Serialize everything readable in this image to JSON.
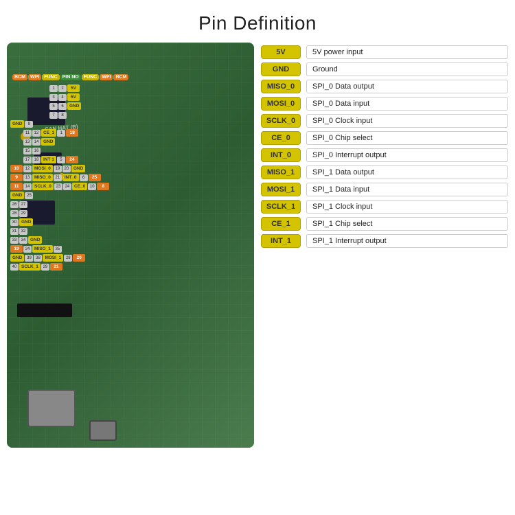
{
  "page": {
    "title": "Pin Definition"
  },
  "header_labels": {
    "bcm": "BCM",
    "wpi": "WPI",
    "func_left": "FUNC",
    "pin_no": "PIN NO",
    "func_right": "FUNC",
    "wpi_right": "WPI",
    "bcm_right": "BCM"
  },
  "legend": [
    {
      "badge": "5V",
      "desc": "5V power input"
    },
    {
      "badge": "GND",
      "desc": "Ground"
    },
    {
      "badge": "MISO_0",
      "desc": "SPI_0 Data output"
    },
    {
      "badge": "MOSI_0",
      "desc": "SPI_0 Data input"
    },
    {
      "badge": "SCLK_0",
      "desc": "SPI_0 Clock input"
    },
    {
      "badge": "CE_0",
      "desc": "SPI_0 Chip select"
    },
    {
      "badge": "INT_0",
      "desc": "SPI_0 Interrupt output"
    },
    {
      "badge": "MISO_1",
      "desc": "SPI_1 Data output"
    },
    {
      "badge": "MOSI_1",
      "desc": "SPI_1 Data input"
    },
    {
      "badge": "SCLK_1",
      "desc": "SPI_1 Clock input"
    },
    {
      "badge": "CE_1",
      "desc": "SPI_1 Chip select"
    },
    {
      "badge": "INT_1",
      "desc": "SPI_1 Interrupt output"
    }
  ],
  "pcb": {
    "label": "CAN HAT (B)"
  }
}
